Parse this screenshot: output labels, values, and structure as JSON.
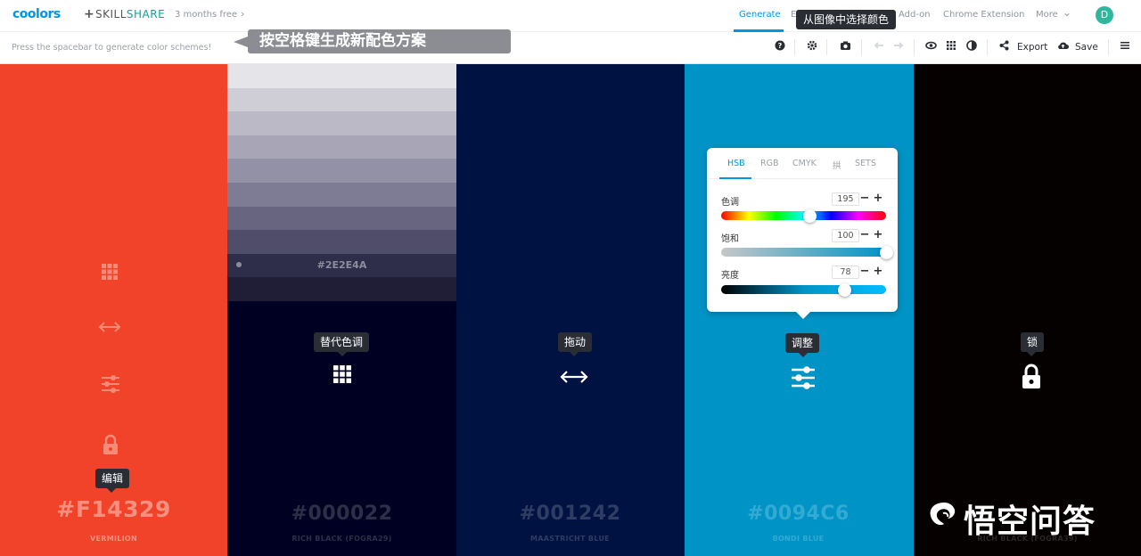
{
  "topnav": {
    "logo": "coolors",
    "plus": "+",
    "partner_a": "SKILL",
    "partner_b": "SHARE",
    "promo": "3 months free",
    "promo_chevron": "›",
    "items": [
      {
        "label": "Generate",
        "active": true
      },
      {
        "label": "E",
        "active": false
      },
      {
        "label": "Add-on",
        "active": false
      },
      {
        "label": "Chrome Extension",
        "active": false
      },
      {
        "label": "More",
        "active": false
      }
    ],
    "more_chevron": "⌄",
    "avatar_letter": "D",
    "tooltip": "从图像中选择颜色"
  },
  "toolbar": {
    "hint": "Press the spacebar to generate color schemes!",
    "banner": "按空格键生成新配色方案",
    "icons": [
      {
        "name": "help-icon",
        "glyph": "?"
      },
      {
        "name": "settings-icon",
        "glyph": "⚙"
      },
      {
        "name": "camera-icon",
        "glyph": "◙"
      },
      {
        "name": "undo-icon",
        "glyph": "←"
      },
      {
        "name": "redo-icon",
        "glyph": "→"
      },
      {
        "name": "eye-icon",
        "glyph": "◉"
      },
      {
        "name": "grid-icon",
        "glyph": "▦"
      },
      {
        "name": "contrast-icon",
        "glyph": "◐"
      },
      {
        "name": "share-icon",
        "glyph": "<"
      },
      {
        "name": "cloud-icon",
        "glyph": "☁"
      },
      {
        "name": "menu-icon",
        "glyph": "≡"
      }
    ],
    "export_label": "Export",
    "save_label": "Save"
  },
  "columns": [
    {
      "hex": "#F14329",
      "name": "VERMILION",
      "bg": "#f14329"
    },
    {
      "hex": "#000022",
      "name": "RICH BLACK (FOGRA29)",
      "bg": "#000022"
    },
    {
      "hex": "#001242",
      "name": "MAASTRICHT BLUE",
      "bg": "#001242"
    },
    {
      "hex": "#0094C6",
      "name": "BONDI BLUE",
      "bg": "#0094c6"
    },
    {
      "hex": "",
      "name": "RICH BLACK (FOGRA39)",
      "bg": "#040100"
    }
  ],
  "shades": {
    "colors": [
      "#e5e4e9",
      "#cfcdd6",
      "#bbb9c6",
      "#a8a6b6",
      "#9391a6",
      "#7e7c95",
      "#67657f",
      "#4f4d69",
      "#2e2e4a",
      "#1f1e36"
    ],
    "label": "#2E2E4A"
  },
  "col1_tooltip": "编辑",
  "col2_tooltip": "替代色调",
  "col3_tooltip": "拖动",
  "col4_tooltip": "调整",
  "col5_tooltip": "锁",
  "panel": {
    "tabs": [
      "HSB",
      "RGB",
      "CMYK",
      "拱",
      "SETS"
    ],
    "active_tab": "HSB",
    "rows": [
      {
        "label": "色调",
        "value": "195",
        "position": 0.54
      },
      {
        "label": "饱和",
        "value": "100",
        "position": 1.0
      },
      {
        "label": "亮度",
        "value": "78",
        "position": 0.75
      }
    ],
    "minus": "−",
    "plus": "+"
  },
  "watermark": "悟空问答"
}
